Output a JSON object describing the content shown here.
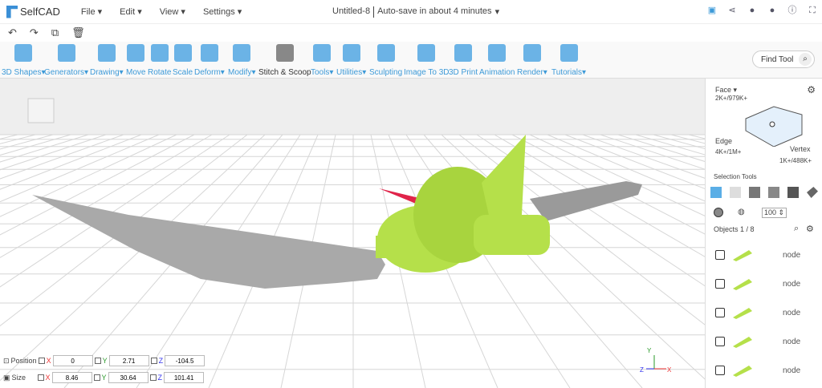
{
  "app": {
    "name": "SelfCAD"
  },
  "menu": [
    "File",
    "Edit",
    "View",
    "Settings"
  ],
  "document": {
    "title": "Untitled-8",
    "autosave": "Auto-save in about 4 minutes"
  },
  "toolbar": {
    "tools": [
      "3D Shapes",
      "Generators",
      "Drawing",
      "Move",
      "Rotate",
      "Scale",
      "Deform",
      "Modify",
      "Stitch & Scoop",
      "Tools",
      "Utilities",
      "Sculpting",
      "Image To 3D",
      "3D Print",
      "Animation",
      "Render",
      "Tutorials"
    ],
    "dropdown": [
      true,
      true,
      true,
      false,
      false,
      false,
      true,
      true,
      false,
      true,
      true,
      false,
      false,
      false,
      false,
      true,
      true
    ],
    "find_placeholder": "Find Tool"
  },
  "selection": {
    "face_label": "Face",
    "face_count": "2K+/979K+",
    "edge_label": "Edge",
    "edge_count": "4K+/1M+",
    "vertex_label": "Vertex",
    "vertex_count": "1K+/488K+",
    "tools_label": "Selection Tools",
    "brush_size": "100"
  },
  "objects": {
    "header": "Objects 1 / 8",
    "items": [
      {
        "name": "node"
      },
      {
        "name": "node"
      },
      {
        "name": "node"
      },
      {
        "name": "node"
      },
      {
        "name": "node"
      }
    ]
  },
  "transform": {
    "position_label": "Position",
    "size_label": "Size",
    "position": {
      "x": "0",
      "y": "2.71",
      "z": "-104.5"
    },
    "size": {
      "x": "8.46",
      "y": "30.64",
      "z": "101.41"
    }
  },
  "axes": {
    "x": "X",
    "y": "Y",
    "z": "Z"
  },
  "colors": {
    "accent": "#3d9ad8",
    "model_green": "#b5e04a",
    "blade_gray": "#a8a8a8",
    "red_spike": "#e0244a"
  }
}
